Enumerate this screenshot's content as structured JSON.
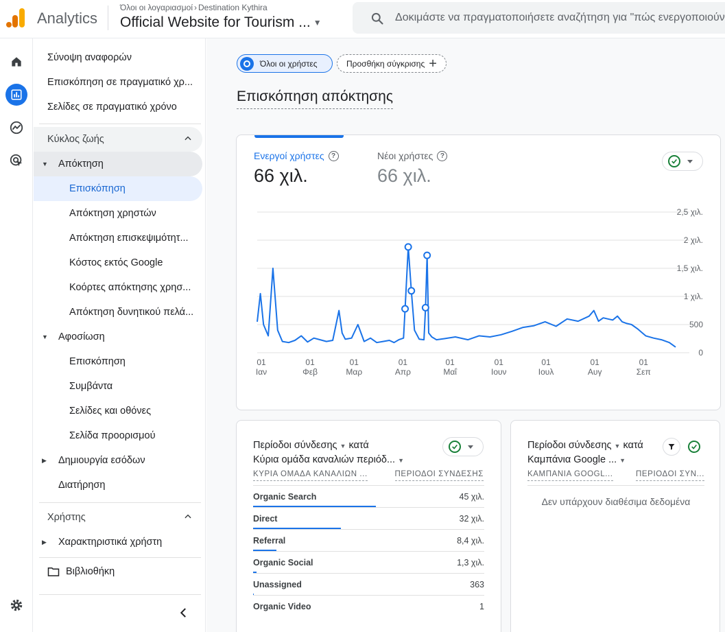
{
  "topbar": {
    "brand": "Analytics",
    "crumb_root": "Όλοι οι λογαριασμοί",
    "crumb_account": "Destination Kythira",
    "property": "Official Website for Tourism ...",
    "search_placeholder": "Δοκιμάστε να πραγματοποιήσετε αναζήτηση για \"πώς ενεργοποιούνται οι"
  },
  "nav": {
    "reports_snapshot": "Σύνοψη αναφορών",
    "realtime_overview": "Επισκόπηση σε πραγματικό χρ...",
    "realtime_pages": "Σελίδες σε πραγματικό χρόνο",
    "lifecycle": "Κύκλος ζωής",
    "acquisition": "Απόκτηση",
    "acq_items": [
      "Επισκόπηση",
      "Απόκτηση χρηστών",
      "Απόκτηση επισκεψιμότητ...",
      "Κόστος εκτός Google",
      "Κοόρτες απόκτησης χρησ...",
      "Απόκτηση δυνητικού πελά..."
    ],
    "engagement": "Αφοσίωση",
    "eng_items": [
      "Επισκόπηση",
      "Συμβάντα",
      "Σελίδες και οθόνες",
      "Σελίδα προορισμού"
    ],
    "monetization": "Δημιουργία εσόδων",
    "retention": "Διατήρηση",
    "user": "Χρήστης",
    "user_attributes": "Χαρακτηριστικά χρήστη",
    "library": "Βιβλιοθήκη"
  },
  "main": {
    "chip_all_users": "Όλοι οι χρήστες",
    "chip_add_comparison": "Προσθήκη σύγκρισης",
    "title": "Επισκόπηση απόκτησης"
  },
  "summary_card": {
    "metric1_label": "Ενεργοί χρήστες",
    "metric1_value": "66 χιλ.",
    "metric2_label": "Νέοι χρήστες",
    "metric2_value": "66 χιλ."
  },
  "chart_data": {
    "type": "line",
    "y_ticks": [
      "2,5 χιλ.",
      "2 χιλ.",
      "1,5 χιλ.",
      "1 χιλ.",
      "500",
      "0"
    ],
    "ylim": [
      0,
      2500
    ],
    "x_ticks": [
      {
        "day": "01",
        "month": "Ιαν"
      },
      {
        "day": "01",
        "month": "Φεβ"
      },
      {
        "day": "01",
        "month": "Μαρ"
      },
      {
        "day": "01",
        "month": "Απρ"
      },
      {
        "day": "01",
        "month": "Μαΐ"
      },
      {
        "day": "01",
        "month": "Ιουν"
      },
      {
        "day": "01",
        "month": "Ιουλ"
      },
      {
        "day": "01",
        "month": "Αυγ"
      },
      {
        "day": "01",
        "month": "Σεπ"
      }
    ],
    "series": [
      {
        "color": "#1a73e8",
        "x": [
          "Jan 01",
          "Jan 03",
          "Jan 05",
          "Jan 08",
          "Jan 11",
          "Jan 14",
          "Jan 17",
          "Jan 21",
          "Jan 25",
          "Jan 29",
          "Feb 02",
          "Feb 06",
          "Feb 10",
          "Feb 14",
          "Feb 18",
          "Feb 22",
          "Feb 24",
          "Feb 26",
          "Mar 02",
          "Mar 06",
          "Mar 10",
          "Mar 14",
          "Mar 18",
          "Mar 22",
          "Mar 26",
          "Mar 29",
          "Apr 01",
          "Apr 04",
          "Apr 05",
          "Apr 07",
          "Apr 09",
          "Apr 11",
          "Apr 14",
          "Apr 17",
          "Apr 18",
          "Apr 19",
          "Apr 20",
          "Apr 22",
          "Apr 25",
          "Apr 30",
          "May 07",
          "May 15",
          "May 22",
          "May 29",
          "Jun 05",
          "Jun 12",
          "Jun 19",
          "Jun 26",
          "Jul 03",
          "Jul 10",
          "Jul 17",
          "Jul 24",
          "Jul 31",
          "Aug 03",
          "Aug 06",
          "Aug 09",
          "Aug 12",
          "Aug 15",
          "Aug 18",
          "Aug 21",
          "Aug 24",
          "Aug 27",
          "Aug 31",
          "Sep 05",
          "Sep 10",
          "Sep 15",
          "Sep 20",
          "Sep 24"
        ],
        "values": [
          550,
          1050,
          500,
          300,
          1500,
          400,
          200,
          180,
          220,
          300,
          190,
          260,
          230,
          200,
          220,
          750,
          350,
          240,
          260,
          500,
          200,
          260,
          180,
          200,
          220,
          180,
          230,
          260,
          780,
          1880,
          1100,
          400,
          240,
          230,
          800,
          1730,
          350,
          280,
          230,
          250,
          280,
          230,
          300,
          280,
          320,
          380,
          450,
          480,
          550,
          470,
          600,
          560,
          650,
          750,
          560,
          620,
          600,
          580,
          650,
          550,
          520,
          500,
          420,
          300,
          260,
          230,
          180,
          100
        ]
      }
    ]
  },
  "card_channels": {
    "title_prefix": "Περίοδοι σύνδεσης",
    "title_by": "κατά",
    "title_dimension": "Κύρια ομάδα καναλιών περιόδ...",
    "col_dim": "ΚΥΡΙΑ ΟΜΑΔΑ ΚΑΝΑΛΙΩΝ ...",
    "col_metric": "ΠΕΡΙΟΔΟΙ ΣΥΝΔΕΣΗΣ",
    "rows": [
      {
        "name": "Organic Search",
        "value": "45 χιλ.",
        "share": 0.53
      },
      {
        "name": "Direct",
        "value": "32 χιλ.",
        "share": 0.38
      },
      {
        "name": "Referral",
        "value": "8,4 χιλ.",
        "share": 0.1
      },
      {
        "name": "Organic Social",
        "value": "1,3 χιλ.",
        "share": 0.016
      },
      {
        "name": "Unassigned",
        "value": "363",
        "share": 0.004
      },
      {
        "name": "Organic Video",
        "value": "1",
        "share": 0.0
      }
    ]
  },
  "card_campaigns": {
    "title_prefix": "Περίοδοι σύνδεσης",
    "title_by": "κατά",
    "title_dimension": "Καμπάνια Google ...",
    "col_dim": "ΚΑΜΠΑΝΙΑ GOOGL...",
    "col_metric": "ΠΕΡΙΟΔΟΙ ΣΥΝ...",
    "empty": "Δεν υπάρχουν διαθέσιμα δεδομένα"
  }
}
